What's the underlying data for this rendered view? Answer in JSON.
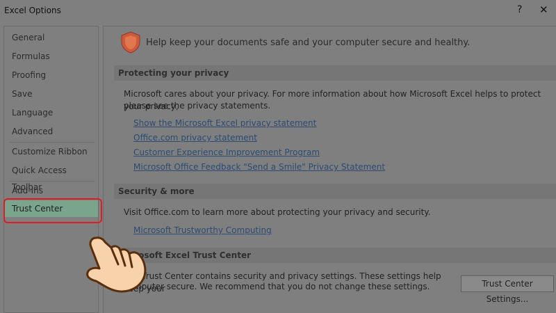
{
  "window": {
    "title": "Excel Options",
    "help_glyph": "?",
    "close_glyph": "✕"
  },
  "sidebar": {
    "items": [
      {
        "label": "General"
      },
      {
        "label": "Formulas"
      },
      {
        "label": "Proofing"
      },
      {
        "label": "Save"
      },
      {
        "label": "Language"
      },
      {
        "label": "Advanced"
      },
      {
        "label": "Customize Ribbon"
      },
      {
        "label": "Quick Access Toolbar"
      },
      {
        "label": "Add-Ins"
      },
      {
        "label": "Trust Center",
        "selected": true
      }
    ]
  },
  "main": {
    "header": "Help keep your documents safe and your computer secure and healthy.",
    "privacy": {
      "title": "Protecting your privacy",
      "text_line1": "Microsoft cares about your privacy. For more information about how Microsoft Excel helps to protect your privacy,",
      "text_line2": "please see the privacy statements.",
      "links": [
        "Show the Microsoft Excel privacy statement",
        "Office.com privacy statement",
        "Customer Experience Improvement Program",
        "Microsoft Office Feedback \"Send a Smile\" Privacy Statement"
      ]
    },
    "security": {
      "title": "Security & more",
      "text": "Visit Office.com to learn more about protecting your privacy and security.",
      "link": "Microsoft Trustworthy Computing"
    },
    "trust_center": {
      "title": "Microsoft Excel Trust Center",
      "text_line1": "The Trust Center contains security and privacy settings. These settings help keep your",
      "text_line2": "computer secure. We recommend that you do not change these settings.",
      "button_label": "Trust Center Settings..."
    }
  },
  "colors": {
    "selected_bg": "#7aa48c",
    "highlight_ring": "#e21b23",
    "shield": "#d9532c",
    "link": "#2b4b74"
  },
  "icons": {
    "shield": "shield-icon",
    "pointer": "pointing-hand-icon"
  }
}
